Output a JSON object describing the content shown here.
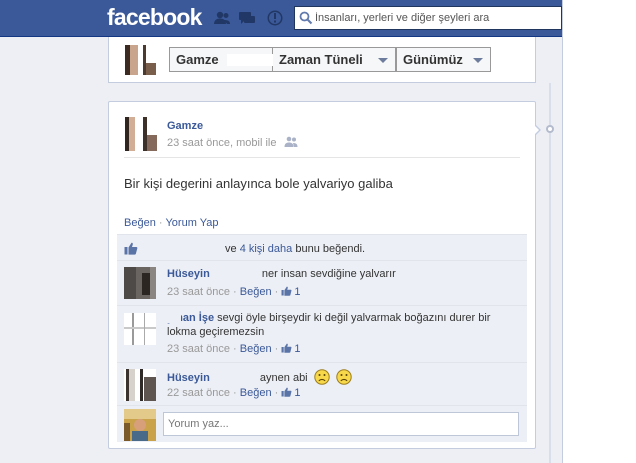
{
  "topbar": {
    "logo": "facebook",
    "search_placeholder": "İnsanları, yerleri ve diğer şeyleri ara",
    "bar_color": "#3b5998"
  },
  "header": {
    "profile_name": "Gamze",
    "timeline_label": "Zaman Tüneli",
    "period_label": "Günümüz"
  },
  "post": {
    "author": "Gamze",
    "time": "23 saat önce",
    "via": "mobil ile",
    "text": "Bir kişi degerini anlayınca bole yalvariyo galiba",
    "like_label": "Beğen",
    "comment_label": "Yorum Yap",
    "separator": "·"
  },
  "likes": {
    "conjunction": "ve",
    "others_link": "4 kişi daha",
    "suffix": "bunu beğendi."
  },
  "comments": [
    {
      "author": "Hüseyin",
      "text": "ner insan sevdiğine yalvarır",
      "time": "23 saat önce",
      "like_label": "Beğen",
      "like_count": "1"
    },
    {
      "author": "yman İşe",
      "text": "sevgi öyle birşeydir ki değil yalvarmak boğazını durer bir lokma geçiremezsin",
      "time": "23 saat önce",
      "like_label": "Beğen",
      "like_count": "1"
    },
    {
      "author": "Hüseyin",
      "text": "aynen abi",
      "time": "22 saat önce",
      "like_label": "Beğen",
      "like_count": "1"
    }
  ],
  "reply": {
    "placeholder": "Yorum yaz..."
  }
}
